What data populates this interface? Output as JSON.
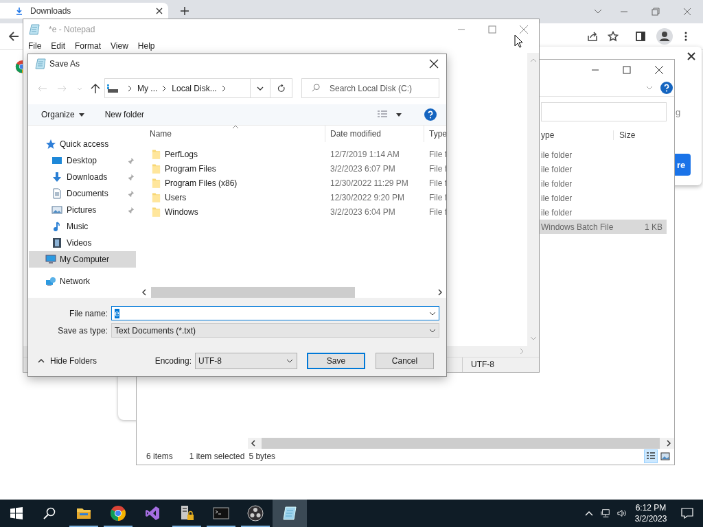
{
  "browser": {
    "tab": {
      "title": "Downloads"
    },
    "download_panel": {
      "text_fragment": "g",
      "button": "re"
    }
  },
  "explorer": {
    "columns": [
      "ype",
      "Size"
    ],
    "rows": [
      {
        "type": "ile folder",
        "selected": false
      },
      {
        "type": "ile folder",
        "selected": false
      },
      {
        "type": "ile folder",
        "selected": false
      },
      {
        "type": "ile folder",
        "selected": false
      },
      {
        "type": "ile folder",
        "selected": false
      },
      {
        "type": "Windows Batch File",
        "size": "1 KB",
        "selected": true
      }
    ],
    "status": [
      "6 items",
      "1 item selected",
      "5 bytes"
    ],
    "views": [
      {
        "kind": "details",
        "selected": true
      },
      {
        "kind": "thumbnails",
        "selected": false
      }
    ]
  },
  "notepad": {
    "title": "*e - Notepad",
    "menu": [
      "File",
      "Edit",
      "Format",
      "View",
      "Help"
    ],
    "encoding": "UTF-8"
  },
  "save_dialog": {
    "title": "Save As",
    "breadcrumb": [
      "My ...",
      "Local Disk..."
    ],
    "search": {
      "placeholder": "Search Local Disk (C:)"
    },
    "toolbar": {
      "organize": "Organize",
      "new_folder": "New folder"
    },
    "nav": [
      {
        "label": "Quick access",
        "kind": "star",
        "selected": false,
        "children": [
          {
            "label": "Desktop",
            "kind": "desktop",
            "pinned": true,
            "selected": false
          },
          {
            "label": "Downloads",
            "kind": "download",
            "pinned": true,
            "selected": false
          },
          {
            "label": "Documents",
            "kind": "document",
            "pinned": true,
            "selected": false
          },
          {
            "label": "Pictures",
            "kind": "pictures",
            "pinned": true,
            "selected": false
          },
          {
            "label": "Music",
            "kind": "music",
            "pinned": false,
            "selected": false
          },
          {
            "label": "Videos",
            "kind": "video",
            "pinned": false,
            "selected": false
          }
        ]
      },
      {
        "label": "My Computer",
        "kind": "computer",
        "selected": true
      },
      {
        "label": "Network",
        "kind": "network",
        "selected": false
      }
    ],
    "columns": [
      "Name",
      "Date modified",
      "Type"
    ],
    "files": [
      {
        "name": "PerfLogs",
        "date": "12/7/2019 1:14 AM",
        "type": "File f"
      },
      {
        "name": "Program Files",
        "date": "3/2/2023 6:07 PM",
        "type": "File f"
      },
      {
        "name": "Program Files (x86)",
        "date": "12/30/2022 11:29 PM",
        "type": "File f"
      },
      {
        "name": "Users",
        "date": "12/30/2022 9:20 PM",
        "type": "File f"
      },
      {
        "name": "Windows",
        "date": "3/2/2023 6:04 PM",
        "type": "File f"
      }
    ],
    "file_name": {
      "label": "File name:",
      "value": "e",
      "value_selected": true
    },
    "save_type": {
      "label": "Save as type:",
      "value": "Text Documents (*.txt)"
    },
    "hide_folders": "Hide Folders",
    "encoding": {
      "label": "Encoding:",
      "value": "UTF-8"
    },
    "buttons": [
      {
        "label": "Save",
        "default": true
      },
      {
        "label": "Cancel",
        "default": false
      }
    ]
  },
  "taskbar": {
    "apps": [
      {
        "kind": "folder",
        "running": true,
        "active": false
      },
      {
        "kind": "chrome",
        "running": true,
        "active": false
      },
      {
        "kind": "studio",
        "running": false,
        "active": false
      },
      {
        "kind": "server",
        "running": true,
        "active": false
      },
      {
        "kind": "terminal",
        "running": true,
        "active": false
      },
      {
        "kind": "obs",
        "running": true,
        "active": false
      },
      {
        "kind": "notepad",
        "running": false,
        "active": true
      }
    ],
    "time": "6:12 PM",
    "date": "3/2/2023"
  }
}
